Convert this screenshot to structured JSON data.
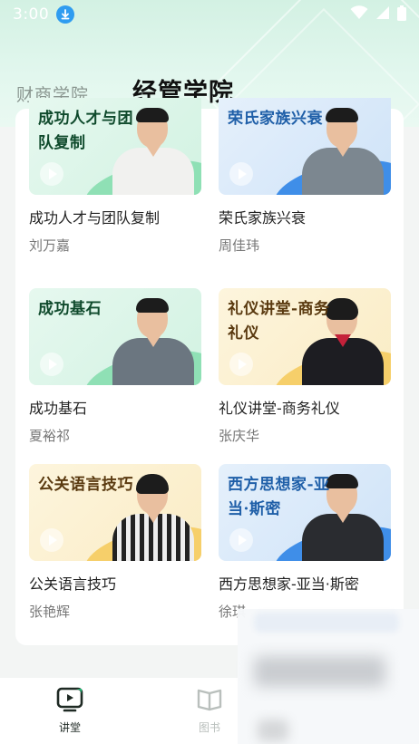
{
  "status_bar": {
    "time": "3:00",
    "download_icon": "download-icon",
    "wifi_icon": "wifi-icon",
    "signal_icon": "signal-icon",
    "battery_icon": "battery-icon"
  },
  "tabs": [
    {
      "label": "财商学院",
      "active": false
    },
    {
      "label": "经管学院",
      "active": true
    }
  ],
  "colors": {
    "accent": "#1fbf77",
    "header_bg": "#d3f1e3",
    "nav_active": "#1f2a24",
    "nav_inactive": "#b9bfbc"
  },
  "courses": [
    {
      "thumb_title": "成功人才与团队复制",
      "title": "成功人才与团队复制",
      "author": "刘万嘉",
      "theme": "green"
    },
    {
      "thumb_title": "荣氏家族兴衰",
      "title": "荣氏家族兴衰",
      "author": "周佳玮",
      "theme": "blue"
    },
    {
      "thumb_title": "成功基石",
      "title": "成功基石",
      "author": "夏裕祁",
      "theme": "green"
    },
    {
      "thumb_title": "礼仪讲堂-商务礼仪",
      "title": "礼仪讲堂-商务礼仪",
      "author": "张庆华",
      "theme": "yellow"
    },
    {
      "thumb_title": "公关语言技巧",
      "title": "公关语言技巧",
      "author": "张艳辉",
      "theme": "yellow"
    },
    {
      "thumb_title": "西方思想家-亚当·斯密",
      "title": "西方思想家-亚当·斯密",
      "author": "徐琪",
      "theme": "blue"
    }
  ],
  "bottom_nav": [
    {
      "label": "讲堂",
      "icon": "lecture-tv-icon",
      "active": true
    },
    {
      "label": "图书",
      "icon": "book-icon",
      "active": false
    }
  ]
}
